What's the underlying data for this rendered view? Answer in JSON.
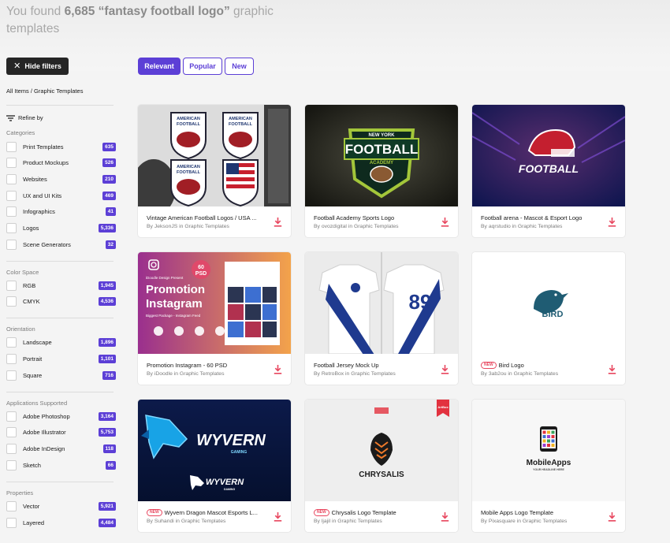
{
  "header": {
    "title_prefix": "You found",
    "title_count": "6,685 “fantasy football logo”",
    "title_suffix": "graphic templates"
  },
  "toolbar": {
    "hide_filters_label": "Hide filters",
    "sort_options": [
      "Relevant",
      "Popular",
      "New"
    ],
    "active_sort": "Relevant"
  },
  "breadcrumb": {
    "root": "All Items",
    "separator": "/",
    "current": "Graphic Templates"
  },
  "sidebar": {
    "refine_label": "Refine by",
    "sections": [
      {
        "title": "Categories",
        "items": [
          {
            "label": "Print Templates",
            "count": "635"
          },
          {
            "label": "Product Mockups",
            "count": "526"
          },
          {
            "label": "Websites",
            "count": "210"
          },
          {
            "label": "UX and UI Kits",
            "count": "469"
          },
          {
            "label": "Infographics",
            "count": "41"
          },
          {
            "label": "Logos",
            "count": "5,336"
          },
          {
            "label": "Scene Generators",
            "count": "32"
          }
        ]
      },
      {
        "title": "Color Space",
        "items": [
          {
            "label": "RGB",
            "count": "1,945"
          },
          {
            "label": "CMYK",
            "count": "4,536"
          }
        ]
      },
      {
        "title": "Orientation",
        "items": [
          {
            "label": "Landscape",
            "count": "1,896"
          },
          {
            "label": "Portrait",
            "count": "1,101"
          },
          {
            "label": "Square",
            "count": "716"
          }
        ]
      },
      {
        "title": "Applications Supported",
        "items": [
          {
            "label": "Adobe Photoshop",
            "count": "3,164"
          },
          {
            "label": "Adobe Illustrator",
            "count": "5,753"
          },
          {
            "label": "Adobe InDesign",
            "count": "118"
          },
          {
            "label": "Sketch",
            "count": "66"
          }
        ]
      },
      {
        "title": "Properties",
        "items": [
          {
            "label": "Vector",
            "count": "5,921"
          },
          {
            "label": "Layered",
            "count": "4,484"
          }
        ]
      }
    ]
  },
  "results": [
    {
      "title": "Vintage American Football Logos / USA ...",
      "author": "By JeksonJS in Graphic Templates",
      "is_new": false,
      "thumb_text": [
        "AMERICAN",
        "FOOTBALL"
      ]
    },
    {
      "title": "Football Academy Sports Logo",
      "author": "By ovozdigital in Graphic Templates",
      "is_new": false,
      "thumb_text": [
        "NEW YORK",
        "FOOTBALL",
        "ACADEMY"
      ]
    },
    {
      "title": "Football arena - Mascot & Esport Logo",
      "author": "By aqrstudio in Graphic Templates",
      "is_new": false,
      "thumb_text": [
        "FOOTBALL"
      ]
    },
    {
      "title": "Promotion Instagram - 60 PSD",
      "author": "By iDoodle in Graphic Templates",
      "is_new": false,
      "thumb_text": [
        "60",
        "PSD",
        "iDoodle Design Present",
        "Promotion",
        "Instagram",
        "Biggest Package - Instagram Feed"
      ]
    },
    {
      "title": "Football Jersey Mock Up",
      "author": "By RetroBox in Graphic Templates",
      "is_new": false,
      "thumb_text": [
        "89"
      ]
    },
    {
      "title": "Bird Logo",
      "author": "By 3ab2ou in Graphic Templates",
      "is_new": true,
      "thumb_text": [
        "BIRD"
      ]
    },
    {
      "title": "Wyvern Dragon Mascot Esports L...",
      "author": "By Suhandi in Graphic Templates",
      "is_new": true,
      "thumb_text": [
        "WYVERN",
        "GAMING",
        "WYVERN",
        "GAMING"
      ]
    },
    {
      "title": "Chrysalis Logo Template",
      "author": "By ljajil in Graphic Templates",
      "is_new": true,
      "thumb_text": [
        "CHRYSALIS",
        "ArtBox"
      ]
    },
    {
      "title": "Mobile Apps Logo Template",
      "author": "By Pixasquare in Graphic Templates",
      "is_new": false,
      "thumb_text": [
        "MobileApps",
        "YOUR HEADLINE HERE"
      ]
    }
  ],
  "labels": {
    "new_badge": "NEW"
  },
  "colors": {
    "accent": "#5c3fd6",
    "download": "#e8475f",
    "dark_button": "#262626"
  }
}
